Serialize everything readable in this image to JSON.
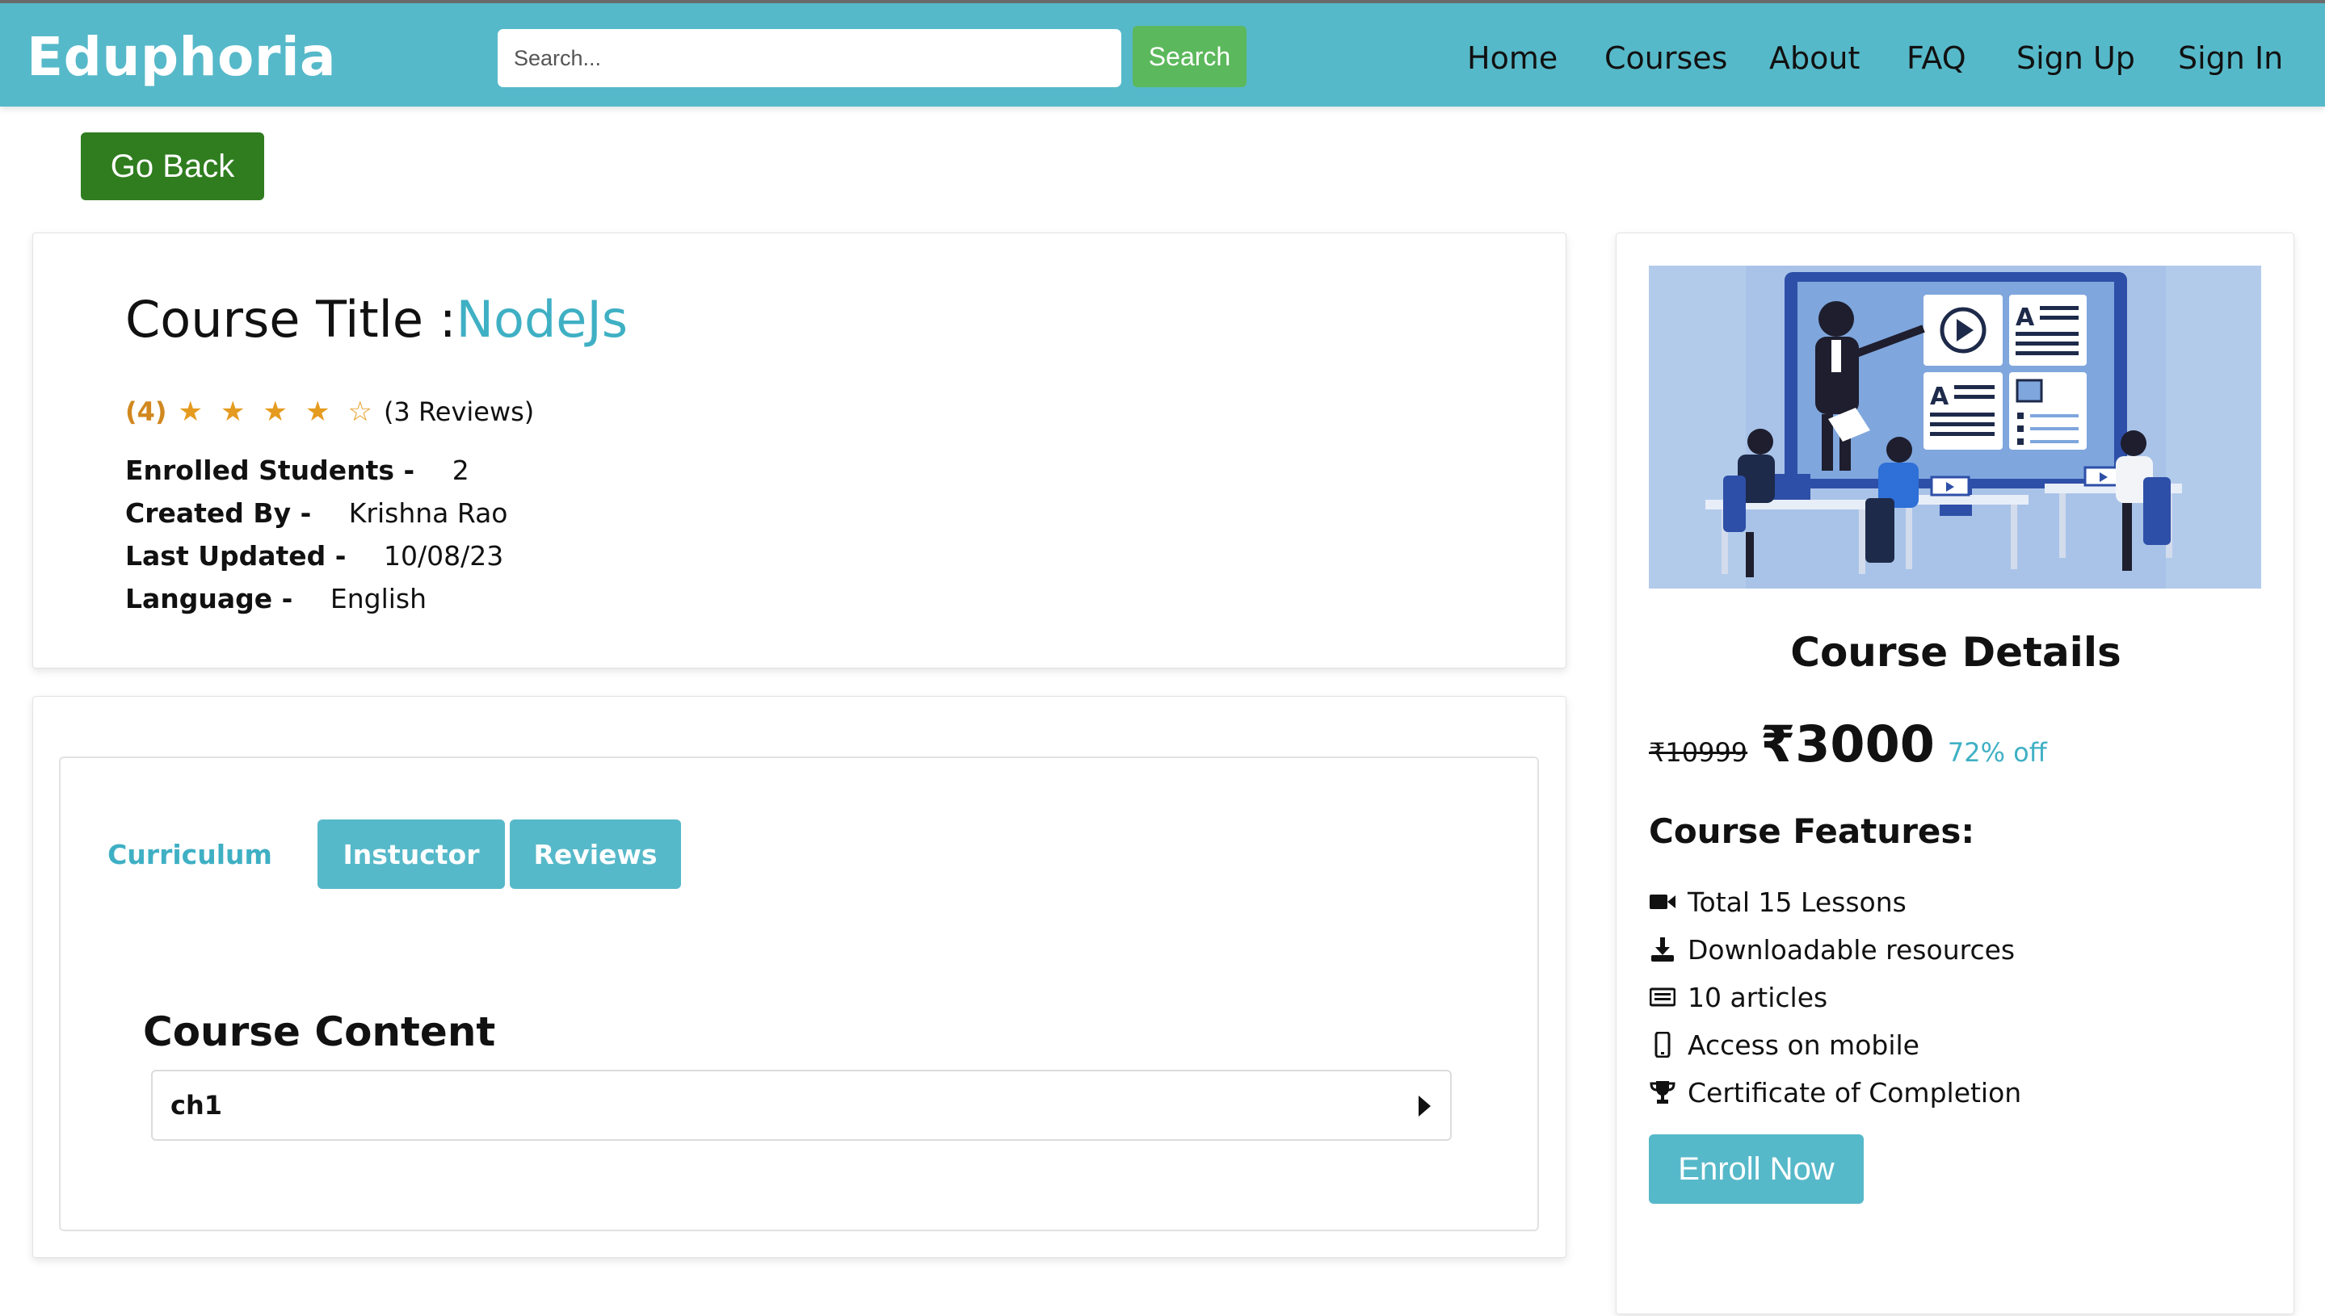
{
  "header": {
    "brand": "Eduphoria",
    "search_placeholder": "Search...",
    "search_button": "Search",
    "nav": [
      "Home",
      "Courses",
      "About",
      "FAQ",
      "Sign Up",
      "Sign In"
    ]
  },
  "go_back": "Go Back",
  "course": {
    "title_label": "Course Title :",
    "title_value": "NodeJs",
    "rating": "(4)",
    "stars_filled": 4,
    "stars_total": 5,
    "reviews": "(3 Reviews)",
    "meta": [
      {
        "label": "Enrolled Students -",
        "value": "2"
      },
      {
        "label": "Created By -",
        "value": "Krishna Rao"
      },
      {
        "label": "Last Updated -",
        "value": "10/08/23"
      },
      {
        "label": "Language -",
        "value": "English"
      }
    ]
  },
  "tabs": [
    "Curriculum",
    "Instuctor",
    "Reviews"
  ],
  "content": {
    "heading": "Course Content",
    "chapters": [
      "ch1"
    ]
  },
  "side": {
    "heading": "Course Details",
    "old_price": "₹10999",
    "new_price": "₹3000",
    "discount": "72% off",
    "features_heading": "Course Features:",
    "features": [
      {
        "icon": "video-icon",
        "text": "Total 15 Lessons"
      },
      {
        "icon": "download-icon",
        "text": "Downloadable resources"
      },
      {
        "icon": "article-icon",
        "text": "10 articles"
      },
      {
        "icon": "mobile-icon",
        "text": "Access on mobile"
      },
      {
        "icon": "trophy-icon",
        "text": "Certificate of Completion"
      }
    ],
    "enroll": "Enroll Now"
  },
  "colors": {
    "header": "#56b9c9",
    "accent": "#3fb0c4",
    "search_button": "#5cb85c",
    "go_back": "#2f7d1f",
    "star": "#e59b1f"
  }
}
